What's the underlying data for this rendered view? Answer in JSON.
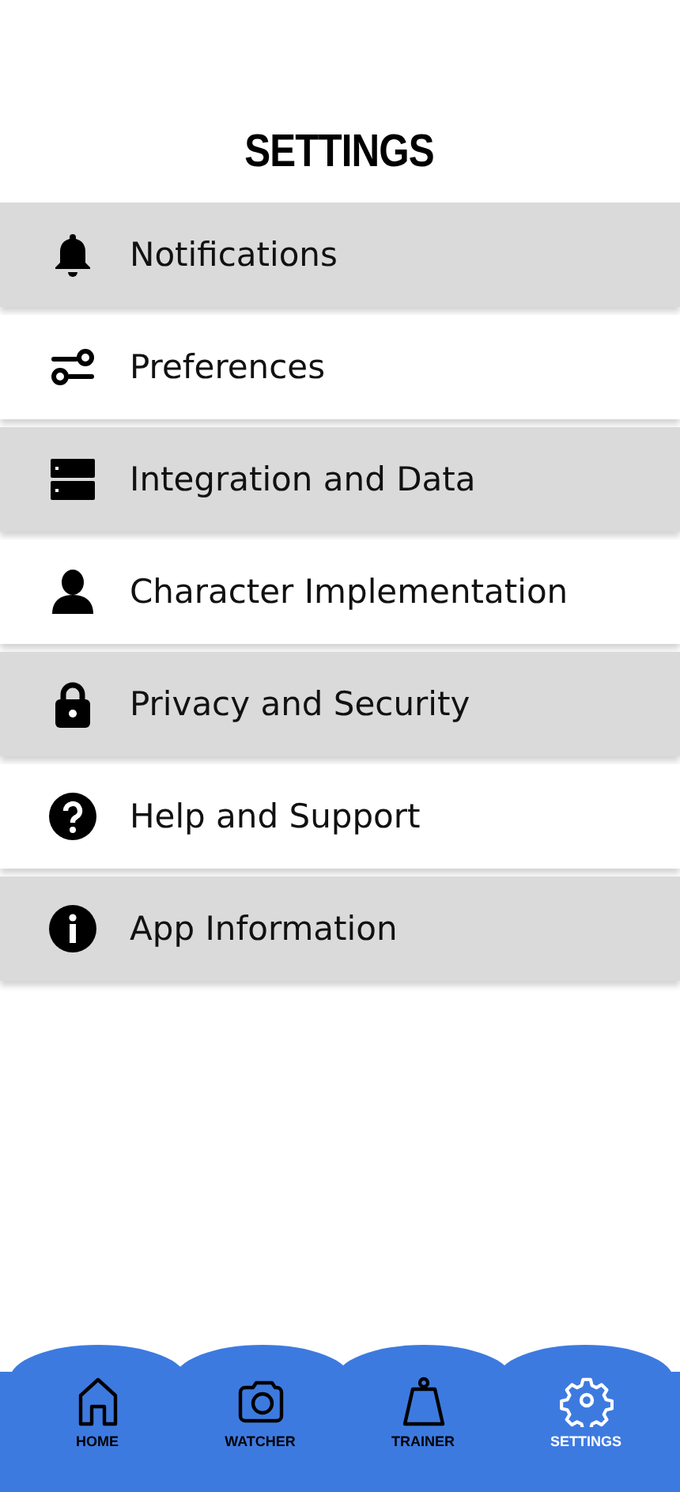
{
  "title": "SETTINGS",
  "settings": [
    {
      "kind": "bell",
      "label": "Notifications"
    },
    {
      "kind": "toggles",
      "label": "Preferences"
    },
    {
      "kind": "storage",
      "label": "Integration and Data"
    },
    {
      "kind": "person",
      "label": "Character Implementation"
    },
    {
      "kind": "lock",
      "label": "Privacy and Security"
    },
    {
      "kind": "help",
      "label": "Help and Support"
    },
    {
      "kind": "info",
      "label": "App Information"
    }
  ],
  "nav": [
    {
      "kind": "home",
      "label": "HOME",
      "selected": false
    },
    {
      "kind": "camera",
      "label": "WATCHER",
      "selected": false
    },
    {
      "kind": "weight",
      "label": "TRAINER",
      "selected": false
    },
    {
      "kind": "gear",
      "label": "SETTINGS",
      "selected": true
    }
  ]
}
